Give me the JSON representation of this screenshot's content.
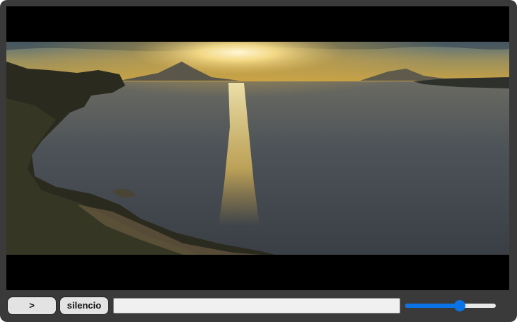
{
  "player": {
    "play_label": ">",
    "mute_label": "silencio",
    "progress_fraction": 0.0,
    "volume_fraction": 0.6,
    "accent_color": "#0a74e6"
  },
  "video": {
    "scene_icon": "sunset-lake-video-frame"
  }
}
